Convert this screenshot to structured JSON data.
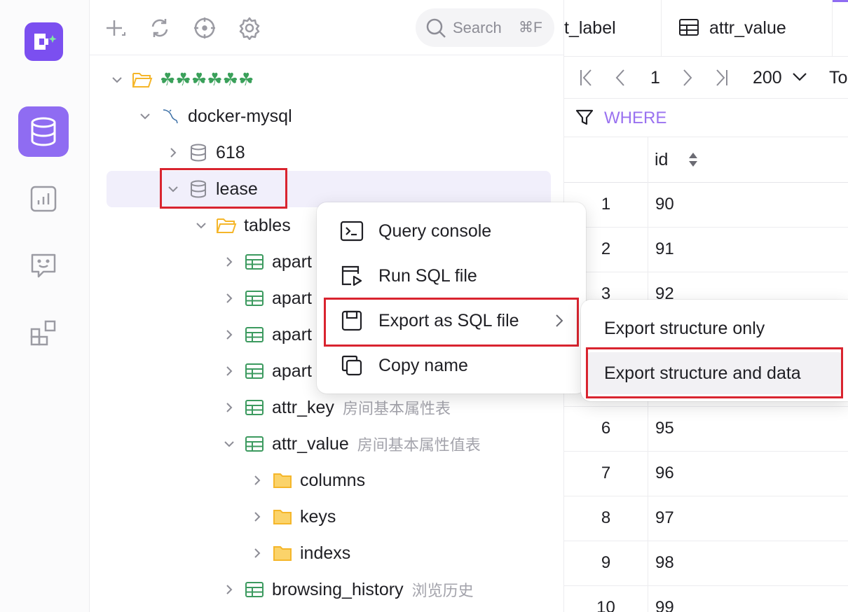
{
  "toolbar": {
    "search_placeholder": "Search",
    "search_shortcut": "⌘F"
  },
  "tree": {
    "group": {
      "label": "☘☘☘☘☘☘"
    },
    "connection": {
      "label": "docker-mysql"
    },
    "databases": [
      {
        "label": "618"
      },
      {
        "label": "lease"
      }
    ],
    "tables_folder": {
      "label": "tables"
    },
    "tables": [
      {
        "label": "apart",
        "comment": ""
      },
      {
        "label": "apart",
        "comment": ""
      },
      {
        "label": "apart",
        "comment": ""
      },
      {
        "label": "apart",
        "comment": ""
      },
      {
        "label": "attr_key",
        "comment": "房间基本属性表"
      },
      {
        "label": "attr_value",
        "comment": "房间基本属性值表"
      },
      {
        "label": "browsing_history",
        "comment": "浏览历史"
      }
    ],
    "subfolders": [
      {
        "label": "columns"
      },
      {
        "label": "keys"
      },
      {
        "label": "indexs"
      }
    ]
  },
  "context_menu": {
    "items": [
      {
        "label": "Query console",
        "icon": "terminal-icon"
      },
      {
        "label": "Run SQL file",
        "icon": "run-file-icon"
      },
      {
        "label": "Export as SQL file",
        "icon": "save-icon",
        "has_submenu": true
      },
      {
        "label": "Copy name",
        "icon": "copy-icon"
      }
    ],
    "submenu": [
      {
        "label": "Export structure only"
      },
      {
        "label": "Export structure and data"
      }
    ]
  },
  "tabs": [
    {
      "label": "t_label"
    },
    {
      "label": "attr_value"
    }
  ],
  "pager": {
    "page": "1",
    "page_size": "200",
    "total_text": "To"
  },
  "where_label": "WHERE",
  "grid": {
    "column": "id",
    "rows": [
      {
        "num": "1",
        "id": "90"
      },
      {
        "num": "2",
        "id": "91"
      },
      {
        "num": "3",
        "id": "92"
      },
      {
        "num": "6",
        "id": "95"
      },
      {
        "num": "7",
        "id": "96"
      },
      {
        "num": "8",
        "id": "97"
      },
      {
        "num": "9",
        "id": "98"
      },
      {
        "num": "10",
        "id": "99"
      }
    ]
  },
  "colors": {
    "accent": "#8f6cf2",
    "logo": "#7b4ff0",
    "highlight_box": "#d9242f",
    "table_icon": "#3c9a5f",
    "folder_icon": "#f5b62a"
  }
}
